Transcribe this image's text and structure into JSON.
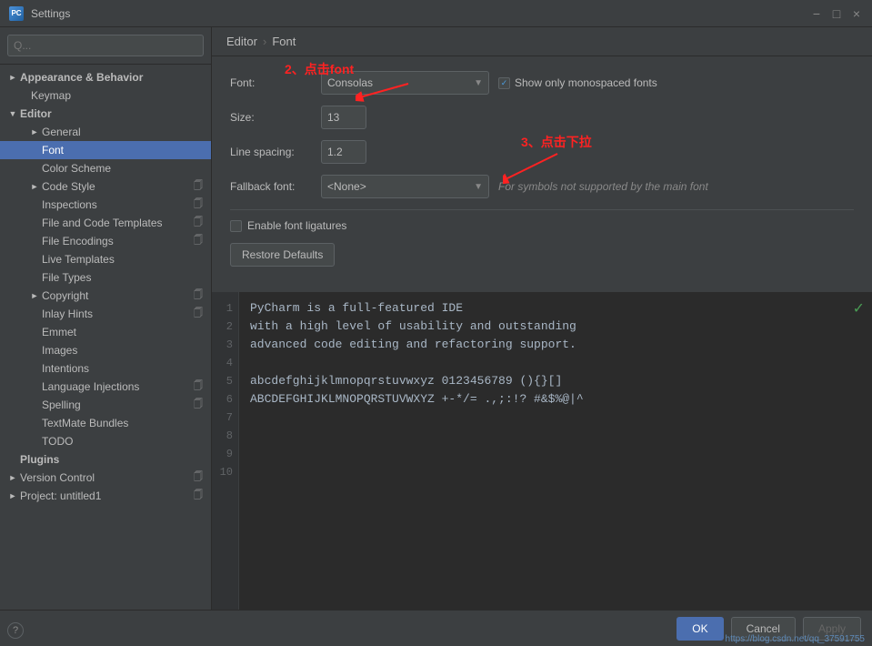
{
  "window": {
    "title": "Settings",
    "icon": "PC"
  },
  "sidebar": {
    "search_placeholder": "Q...",
    "items": [
      {
        "id": "appearance",
        "label": "Appearance & Behavior",
        "level": 1,
        "expandable": true,
        "expanded": false,
        "bold": true
      },
      {
        "id": "keymap",
        "label": "Keymap",
        "level": 2,
        "expandable": false
      },
      {
        "id": "editor",
        "label": "Editor",
        "level": 1,
        "expandable": true,
        "expanded": true,
        "bold": true
      },
      {
        "id": "general",
        "label": "General",
        "level": 3,
        "expandable": true,
        "expanded": false
      },
      {
        "id": "font",
        "label": "Font",
        "level": 3,
        "expandable": false,
        "active": true
      },
      {
        "id": "color-scheme",
        "label": "Color Scheme",
        "level": 3,
        "expandable": false
      },
      {
        "id": "code-style",
        "label": "Code Style",
        "level": 3,
        "expandable": false,
        "has-icon": true
      },
      {
        "id": "inspections",
        "label": "Inspections",
        "level": 3,
        "expandable": false,
        "has-icon": true
      },
      {
        "id": "file-and-code-templates",
        "label": "File and Code Templates",
        "level": 3,
        "expandable": false,
        "has-icon": true
      },
      {
        "id": "file-encodings",
        "label": "File Encodings",
        "level": 3,
        "expandable": false,
        "has-icon": true
      },
      {
        "id": "live-templates",
        "label": "Live Templates",
        "level": 3,
        "expandable": false
      },
      {
        "id": "file-types",
        "label": "File Types",
        "level": 3,
        "expandable": false
      },
      {
        "id": "copyright",
        "label": "Copyright",
        "level": 3,
        "expandable": true,
        "expanded": false,
        "has-icon": true
      },
      {
        "id": "inlay-hints",
        "label": "Inlay Hints",
        "level": 3,
        "expandable": false,
        "has-icon": true
      },
      {
        "id": "emmet",
        "label": "Emmet",
        "level": 3,
        "expandable": false
      },
      {
        "id": "images",
        "label": "Images",
        "level": 3,
        "expandable": false
      },
      {
        "id": "intentions",
        "label": "Intentions",
        "level": 3,
        "expandable": false
      },
      {
        "id": "language-injections",
        "label": "Language Injections",
        "level": 3,
        "expandable": false,
        "has-icon": true
      },
      {
        "id": "spelling",
        "label": "Spelling",
        "level": 3,
        "expandable": false,
        "has-icon": true
      },
      {
        "id": "textmate-bundles",
        "label": "TextMate Bundles",
        "level": 3,
        "expandable": false
      },
      {
        "id": "todo",
        "label": "TODO",
        "level": 3,
        "expandable": false
      },
      {
        "id": "plugins",
        "label": "Plugins",
        "level": 1,
        "expandable": false,
        "bold": true
      },
      {
        "id": "version-control",
        "label": "Version Control",
        "level": 1,
        "expandable": true,
        "has-icon": true
      },
      {
        "id": "project",
        "label": "Project: untitled1",
        "level": 1,
        "expandable": true,
        "has-icon": true
      }
    ]
  },
  "breadcrumb": {
    "parent": "Editor",
    "current": "Font"
  },
  "form": {
    "font_label": "Font:",
    "font_value": "Consolas",
    "show_monospaced_label": "Show only monospaced fonts",
    "show_monospaced_checked": true,
    "size_label": "Size:",
    "size_value": "13",
    "line_spacing_label": "Line spacing:",
    "line_spacing_value": "1.2",
    "fallback_font_label": "Fallback font:",
    "fallback_font_value": "<None>",
    "fallback_hint": "For symbols not supported by the main font",
    "enable_ligatures_label": "Enable font ligatures",
    "restore_btn": "Restore Defaults"
  },
  "preview": {
    "lines": [
      {
        "num": 1,
        "text": "PyCharm is a full-featured IDE"
      },
      {
        "num": 2,
        "text": "with a high level of usability and outstanding"
      },
      {
        "num": 3,
        "text": "advanced code editing and refactoring support."
      },
      {
        "num": 4,
        "text": ""
      },
      {
        "num": 5,
        "text": "abcdefghijklmnopqrstuvwxyz 0123456789 (){}[]"
      },
      {
        "num": 6,
        "text": "ABCDEFGHIJKLMNOPQRSTUVWXYZ +-*/= .,;:!? #&$%@|^"
      },
      {
        "num": 7,
        "text": ""
      },
      {
        "num": 8,
        "text": ""
      },
      {
        "num": 9,
        "text": ""
      },
      {
        "num": 10,
        "text": ""
      }
    ]
  },
  "annotations": {
    "step2": "2、点击font",
    "step3": "3、点击下拉"
  },
  "buttons": {
    "ok": "OK",
    "cancel": "Cancel",
    "apply": "Apply"
  },
  "bottom_link": "https://blog.csdn.net/qq_37591755",
  "help_icon": "?"
}
